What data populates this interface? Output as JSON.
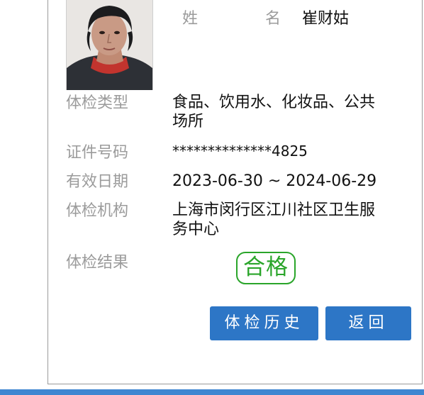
{
  "profile": {
    "name_label": "姓 名",
    "name_value": "崔财姑"
  },
  "fields": {
    "exam_type_label": "体检类型",
    "exam_type_value": "食品、饮用水、化妆品、公共场所",
    "id_label": "证件号码",
    "id_value": "**************4825",
    "validity_label": "有效日期",
    "validity_value": "2023-06-30 ~ 2024-06-29",
    "org_label": "体检机构",
    "org_value": "上海市闵行区江川社区卫生服务中心",
    "result_label": "体检结果",
    "result_value": "合格"
  },
  "buttons": {
    "history_label": "体检历史",
    "back_label": "返回"
  },
  "colors": {
    "button_bg": "#2d76c6",
    "stamp_green": "#2aa52a",
    "bottom_bar": "#3f86d1"
  }
}
